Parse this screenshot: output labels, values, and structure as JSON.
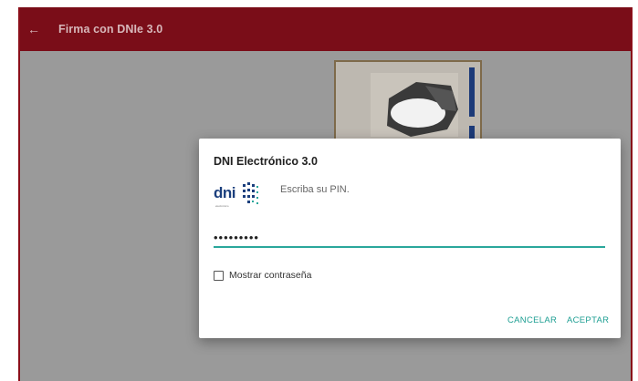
{
  "colors": {
    "toolbar_bg": "#7a0d18",
    "accent": "#1c9e92",
    "scrim": "#9a9a9a"
  },
  "toolbar": {
    "back_icon": "arrow-left-icon",
    "back_glyph": "←",
    "title": "Firma con DNIe 3.0"
  },
  "dialog": {
    "title": "DNI Electrónico 3.0",
    "logo_text": "dni",
    "logo_subtext": "electrónico",
    "prompt": "Escriba su PIN.",
    "pin_value": "•••••••••",
    "show_password_label": "Mostrar contraseña",
    "show_password_checked": false,
    "cancel_label": "CANCELAR",
    "accept_label": "ACEPTAR"
  }
}
